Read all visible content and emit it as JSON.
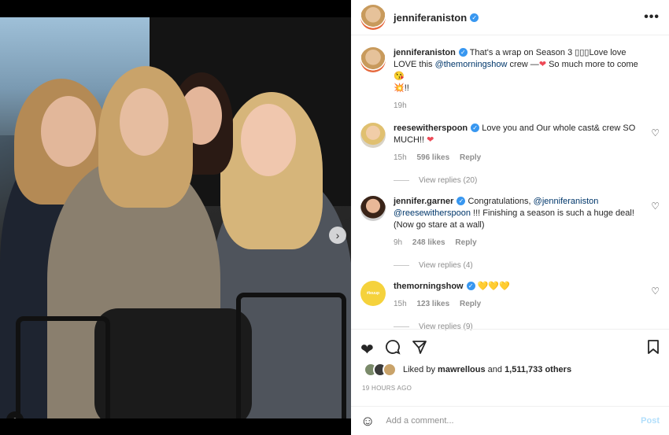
{
  "post": {
    "username": "jenniferaniston",
    "more_icon": "more-options-icon"
  },
  "caption": {
    "username": "jenniferaniston",
    "text_1": "That's a wrap on Season 3 ",
    "emoji_1": "▯▯▯",
    "text_2": "Love love LOVE this ",
    "mention": "@themorningshow",
    "text_3": " crew —",
    "emoji_heart": "❤",
    "text_4": " So much more to come ",
    "emoji_kiss": "😘",
    "emoji_boom": "💥",
    "text_5": "!!",
    "time": "19h"
  },
  "comments": [
    {
      "username": "reesewitherspoon",
      "text": "Love you and Our whole cast& crew SO MUCH!!",
      "emoji": "❤",
      "time": "15h",
      "likes": "596 likes",
      "reply": "Reply",
      "view_replies": "View replies (20)"
    },
    {
      "username": "jennifer.garner",
      "text_pre": "Congratulations, ",
      "mention_1": "@jenniferaniston",
      "mention_2": "@reesewitherspoon",
      "text_post": " !!! Finishing a season is such a huge deal! (Now go stare at a wall)",
      "time": "9h",
      "likes": "248 likes",
      "reply": "Reply",
      "view_replies": "View replies (4)"
    },
    {
      "username": "themorningshow",
      "emoji": "💛💛💛",
      "time": "15h",
      "likes": "123 likes",
      "reply": "Reply",
      "view_replies": "View replies (9)",
      "avatar_text": "#ieuup"
    }
  ],
  "actions": {
    "liked_prefix": "Liked by ",
    "liked_user": "mawrellous",
    "liked_mid": " and ",
    "liked_count": "1,511,733 others",
    "time_ago": "19 HOURS AGO"
  },
  "add_comment": {
    "placeholder": "Add a comment...",
    "post_label": "Post"
  },
  "colors": {
    "verified": "#3897f0",
    "heart_red": "#ed4956",
    "link": "#00376b",
    "muted": "#8e8e8e"
  }
}
